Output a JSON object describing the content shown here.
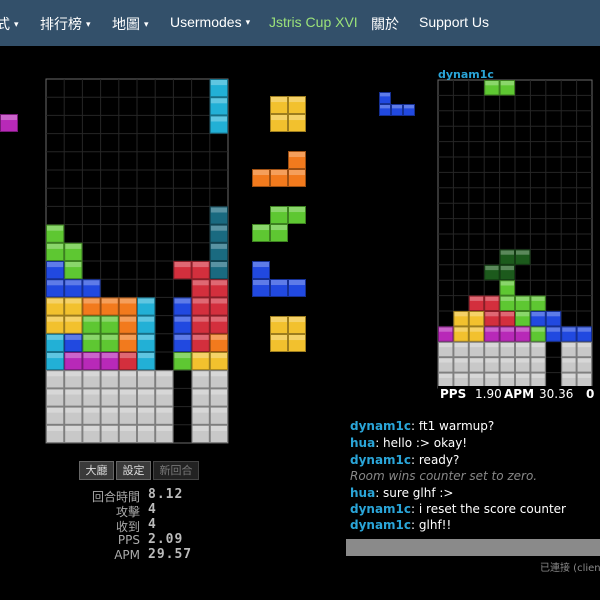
{
  "nav": {
    "items": [
      {
        "label": "式",
        "caret": "▾"
      },
      {
        "label": "排行榜",
        "caret": "▾"
      },
      {
        "label": "地圖",
        "caret": "▾"
      },
      {
        "label": "Usermodes",
        "caret": "▾"
      },
      {
        "label": "Jstris Cup XVI",
        "caret": ""
      },
      {
        "label": "關於",
        "caret": ""
      },
      {
        "label": "Support Us",
        "caret": ""
      }
    ]
  },
  "colors": {
    "navbar": "#33506a",
    "highlight": "#9be27a",
    "username": "#2aa5d8",
    "I": "#22b0d6",
    "O": "#f2c12e",
    "T": "#b829b8",
    "S": "#5ec732",
    "Z": "#d32f3d",
    "J": "#2149e0",
    "L": "#f27a1d",
    "garbage": "#c8c8c8",
    "ghost": "#1a6a80"
  },
  "buttons": {
    "lobby": "大廳",
    "settings": "設定",
    "new_game": "新回合"
  },
  "stats": {
    "time_label": "回合時間",
    "time_value": "8.12",
    "attack_label": "攻擊",
    "attack_value": "4",
    "received_label": "收到",
    "received_value": "4",
    "pps_label": "PPS",
    "pps_value": "2.09",
    "apm_label": "APM",
    "apm_value": "29.57"
  },
  "opponent": {
    "name": "dynam1c",
    "pps_label": "PPS",
    "pps_value": "1.90",
    "apm_label": "APM",
    "apm_value": "30.36",
    "extra_value": "0"
  },
  "chat": {
    "lines": [
      {
        "user": "dynam1c",
        "text": ": ft1 warmup?"
      },
      {
        "user": "hua",
        "text": ": hello :> okay!"
      },
      {
        "user": "dynam1c",
        "text": ": ready?"
      },
      {
        "user": "",
        "text": "Room wins counter set to zero."
      },
      {
        "user": "hua",
        "text": ": sure glhf :>"
      },
      {
        "user": "dynam1c",
        "text": ": i reset the score counter"
      },
      {
        "user": "dynam1c",
        "text": ": glhf!!"
      }
    ],
    "status": "已連接 (client c"
  },
  "board": {
    "cols": 10,
    "rows": 20,
    "cells": [
      {
        "c": 9,
        "r": 0,
        "t": "I"
      },
      {
        "c": 9,
        "r": 1,
        "t": "I"
      },
      {
        "c": 9,
        "r": 2,
        "t": "I"
      },
      {
        "c": 9,
        "r": 7,
        "t": "ghost"
      },
      {
        "c": 9,
        "r": 8,
        "t": "ghost"
      },
      {
        "c": 9,
        "r": 9,
        "t": "ghost"
      },
      {
        "c": 9,
        "r": 10,
        "t": "ghost"
      },
      {
        "c": 0,
        "r": 8,
        "t": "S"
      },
      {
        "c": 0,
        "r": 9,
        "t": "S"
      },
      {
        "c": 1,
        "r": 9,
        "t": "S"
      },
      {
        "c": 1,
        "r": 10,
        "t": "S"
      },
      {
        "c": 0,
        "r": 10,
        "t": "J"
      },
      {
        "c": 0,
        "r": 11,
        "t": "J"
      },
      {
        "c": 1,
        "r": 11,
        "t": "J"
      },
      {
        "c": 2,
        "r": 11,
        "t": "J"
      },
      {
        "c": 7,
        "r": 10,
        "t": "Z"
      },
      {
        "c": 8,
        "r": 10,
        "t": "Z"
      },
      {
        "c": 8,
        "r": 11,
        "t": "Z"
      },
      {
        "c": 9,
        "r": 11,
        "t": "Z"
      },
      {
        "c": 0,
        "r": 12,
        "t": "O"
      },
      {
        "c": 1,
        "r": 12,
        "t": "O"
      },
      {
        "c": 0,
        "r": 13,
        "t": "O"
      },
      {
        "c": 1,
        "r": 13,
        "t": "O"
      },
      {
        "c": 2,
        "r": 12,
        "t": "L"
      },
      {
        "c": 3,
        "r": 12,
        "t": "L"
      },
      {
        "c": 4,
        "r": 12,
        "t": "L"
      },
      {
        "c": 4,
        "r": 13,
        "t": "L"
      },
      {
        "c": 5,
        "r": 12,
        "t": "I"
      },
      {
        "c": 5,
        "r": 13,
        "t": "I"
      },
      {
        "c": 5,
        "r": 14,
        "t": "I"
      },
      {
        "c": 5,
        "r": 15,
        "t": "I"
      },
      {
        "c": 7,
        "r": 12,
        "t": "J"
      },
      {
        "c": 7,
        "r": 13,
        "t": "J"
      },
      {
        "c": 7,
        "r": 14,
        "t": "J"
      },
      {
        "c": 8,
        "r": 12,
        "t": "Z"
      },
      {
        "c": 9,
        "r": 12,
        "t": "Z"
      },
      {
        "c": 2,
        "r": 13,
        "t": "S"
      },
      {
        "c": 3,
        "r": 13,
        "t": "S"
      },
      {
        "c": 2,
        "r": 14,
        "t": "S"
      },
      {
        "c": 3,
        "r": 14,
        "t": "S"
      },
      {
        "c": 8,
        "r": 13,
        "t": "Z"
      },
      {
        "c": 9,
        "r": 13,
        "t": "Z"
      },
      {
        "c": 8,
        "r": 14,
        "t": "Z"
      },
      {
        "c": 0,
        "r": 14,
        "t": "I"
      },
      {
        "c": 0,
        "r": 15,
        "t": "I"
      },
      {
        "c": 1,
        "r": 14,
        "t": "J"
      },
      {
        "c": 1,
        "r": 15,
        "t": "T"
      },
      {
        "c": 2,
        "r": 15,
        "t": "T"
      },
      {
        "c": 3,
        "r": 15,
        "t": "T"
      },
      {
        "c": 4,
        "r": 14,
        "t": "L"
      },
      {
        "c": 4,
        "r": 15,
        "t": "Z"
      },
      {
        "c": 9,
        "r": 14,
        "t": "L"
      },
      {
        "c": 7,
        "r": 15,
        "t": "S"
      },
      {
        "c": 8,
        "r": 15,
        "t": "O"
      },
      {
        "c": 9,
        "r": 15,
        "t": "O"
      },
      {
        "c": 0,
        "r": 16,
        "t": "garbage"
      },
      {
        "c": 1,
        "r": 16,
        "t": "garbage"
      },
      {
        "c": 2,
        "r": 16,
        "t": "garbage"
      },
      {
        "c": 3,
        "r": 16,
        "t": "garbage"
      },
      {
        "c": 4,
        "r": 16,
        "t": "garbage"
      },
      {
        "c": 5,
        "r": 16,
        "t": "garbage"
      },
      {
        "c": 6,
        "r": 16,
        "t": "garbage"
      },
      {
        "c": 8,
        "r": 16,
        "t": "garbage"
      },
      {
        "c": 9,
        "r": 16,
        "t": "garbage"
      },
      {
        "c": 0,
        "r": 17,
        "t": "garbage"
      },
      {
        "c": 1,
        "r": 17,
        "t": "garbage"
      },
      {
        "c": 2,
        "r": 17,
        "t": "garbage"
      },
      {
        "c": 3,
        "r": 17,
        "t": "garbage"
      },
      {
        "c": 4,
        "r": 17,
        "t": "garbage"
      },
      {
        "c": 5,
        "r": 17,
        "t": "garbage"
      },
      {
        "c": 6,
        "r": 17,
        "t": "garbage"
      },
      {
        "c": 8,
        "r": 17,
        "t": "garbage"
      },
      {
        "c": 9,
        "r": 17,
        "t": "garbage"
      },
      {
        "c": 0,
        "r": 18,
        "t": "garbage"
      },
      {
        "c": 1,
        "r": 18,
        "t": "garbage"
      },
      {
        "c": 2,
        "r": 18,
        "t": "garbage"
      },
      {
        "c": 3,
        "r": 18,
        "t": "garbage"
      },
      {
        "c": 4,
        "r": 18,
        "t": "garbage"
      },
      {
        "c": 5,
        "r": 18,
        "t": "garbage"
      },
      {
        "c": 6,
        "r": 18,
        "t": "garbage"
      },
      {
        "c": 8,
        "r": 18,
        "t": "garbage"
      },
      {
        "c": 9,
        "r": 18,
        "t": "garbage"
      },
      {
        "c": 0,
        "r": 19,
        "t": "garbage"
      },
      {
        "c": 1,
        "r": 19,
        "t": "garbage"
      },
      {
        "c": 2,
        "r": 19,
        "t": "garbage"
      },
      {
        "c": 3,
        "r": 19,
        "t": "garbage"
      },
      {
        "c": 4,
        "r": 19,
        "t": "garbage"
      },
      {
        "c": 5,
        "r": 19,
        "t": "garbage"
      },
      {
        "c": 6,
        "r": 19,
        "t": "garbage"
      },
      {
        "c": 8,
        "r": 19,
        "t": "garbage"
      },
      {
        "c": 9,
        "r": 19,
        "t": "garbage"
      }
    ]
  },
  "queue": [
    {
      "t": "O",
      "cells": [
        [
          0,
          0
        ],
        [
          1,
          0
        ],
        [
          0,
          1
        ],
        [
          1,
          1
        ]
      ]
    },
    {
      "t": "L",
      "cells": [
        [
          2,
          0
        ],
        [
          0,
          1
        ],
        [
          1,
          1
        ],
        [
          2,
          1
        ]
      ]
    },
    {
      "t": "S",
      "cells": [
        [
          1,
          0
        ],
        [
          2,
          0
        ],
        [
          0,
          1
        ],
        [
          1,
          1
        ]
      ]
    },
    {
      "t": "J",
      "cells": [
        [
          0,
          0
        ],
        [
          0,
          1
        ],
        [
          1,
          1
        ],
        [
          2,
          1
        ]
      ]
    },
    {
      "t": "O",
      "cells": [
        [
          0,
          0
        ],
        [
          1,
          0
        ],
        [
          0,
          1
        ],
        [
          1,
          1
        ]
      ]
    }
  ],
  "hold": {
    "t": "T",
    "cells": [
      [
        0,
        0
      ],
      [
        0,
        1
      ],
      [
        1,
        1
      ]
    ]
  },
  "opponent_board": {
    "cols": 10,
    "rows": 20,
    "cells": [
      {
        "c": 3,
        "r": 0,
        "t": "S"
      },
      {
        "c": 4,
        "r": 0,
        "t": "S"
      },
      {
        "c": 4,
        "r": 11,
        "t": "ghostS"
      },
      {
        "c": 5,
        "r": 11,
        "t": "ghostS"
      },
      {
        "c": 4,
        "r": 12,
        "t": "ghostS"
      },
      {
        "c": 3,
        "r": 12,
        "t": "ghostS"
      },
      {
        "c": 4,
        "r": 13,
        "t": "S"
      },
      {
        "c": 4,
        "r": 14,
        "t": "S"
      },
      {
        "c": 3,
        "r": 14,
        "t": "Z"
      },
      {
        "c": 2,
        "r": 14,
        "t": "Z"
      },
      {
        "c": 3,
        "r": 15,
        "t": "Z"
      },
      {
        "c": 4,
        "r": 15,
        "t": "Z"
      },
      {
        "c": 5,
        "r": 15,
        "t": "S"
      },
      {
        "c": 5,
        "r": 14,
        "t": "S"
      },
      {
        "c": 6,
        "r": 14,
        "t": "S"
      },
      {
        "c": 1,
        "r": 15,
        "t": "O"
      },
      {
        "c": 2,
        "r": 15,
        "t": "O"
      },
      {
        "c": 1,
        "r": 16,
        "t": "O"
      },
      {
        "c": 2,
        "r": 16,
        "t": "O"
      },
      {
        "c": 3,
        "r": 16,
        "t": "S"
      },
      {
        "c": 4,
        "r": 16,
        "t": "Z"
      },
      {
        "c": 5,
        "r": 16,
        "t": "Z"
      },
      {
        "c": 6,
        "r": 16,
        "t": "S"
      },
      {
        "c": 6,
        "r": 15,
        "t": "J"
      },
      {
        "c": 0,
        "r": 16,
        "t": "T"
      },
      {
        "c": 3,
        "r": 16,
        "t": "T"
      },
      {
        "c": 4,
        "r": 16,
        "t": "T"
      },
      {
        "c": 5,
        "r": 16,
        "t": "T"
      },
      {
        "c": 7,
        "r": 15,
        "t": "J"
      },
      {
        "c": 7,
        "r": 16,
        "t": "J"
      },
      {
        "c": 8,
        "r": 16,
        "t": "J"
      },
      {
        "c": 9,
        "r": 16,
        "t": "J"
      },
      {
        "c": 0,
        "r": 17,
        "t": "garbage"
      },
      {
        "c": 1,
        "r": 17,
        "t": "garbage"
      },
      {
        "c": 2,
        "r": 17,
        "t": "garbage"
      },
      {
        "c": 3,
        "r": 17,
        "t": "garbage"
      },
      {
        "c": 4,
        "r": 17,
        "t": "garbage"
      },
      {
        "c": 5,
        "r": 17,
        "t": "garbage"
      },
      {
        "c": 6,
        "r": 17,
        "t": "garbage"
      },
      {
        "c": 8,
        "r": 17,
        "t": "garbage"
      },
      {
        "c": 9,
        "r": 17,
        "t": "garbage"
      },
      {
        "c": 0,
        "r": 18,
        "t": "garbage"
      },
      {
        "c": 1,
        "r": 18,
        "t": "garbage"
      },
      {
        "c": 2,
        "r": 18,
        "t": "garbage"
      },
      {
        "c": 3,
        "r": 18,
        "t": "garbage"
      },
      {
        "c": 4,
        "r": 18,
        "t": "garbage"
      },
      {
        "c": 5,
        "r": 18,
        "t": "garbage"
      },
      {
        "c": 6,
        "r": 18,
        "t": "garbage"
      },
      {
        "c": 8,
        "r": 18,
        "t": "garbage"
      },
      {
        "c": 9,
        "r": 18,
        "t": "garbage"
      },
      {
        "c": 0,
        "r": 19,
        "t": "garbage"
      },
      {
        "c": 1,
        "r": 19,
        "t": "garbage"
      },
      {
        "c": 2,
        "r": 19,
        "t": "garbage"
      },
      {
        "c": 3,
        "r": 19,
        "t": "garbage"
      },
      {
        "c": 4,
        "r": 19,
        "t": "garbage"
      },
      {
        "c": 5,
        "r": 19,
        "t": "garbage"
      },
      {
        "c": 6,
        "r": 19,
        "t": "garbage"
      },
      {
        "c": 8,
        "r": 19,
        "t": "garbage"
      },
      {
        "c": 9,
        "r": 19,
        "t": "garbage"
      }
    ]
  },
  "opponent_queue": {
    "t": "J",
    "cells": [
      [
        0,
        0
      ],
      [
        0,
        1
      ],
      [
        1,
        1
      ],
      [
        2,
        1
      ]
    ]
  }
}
